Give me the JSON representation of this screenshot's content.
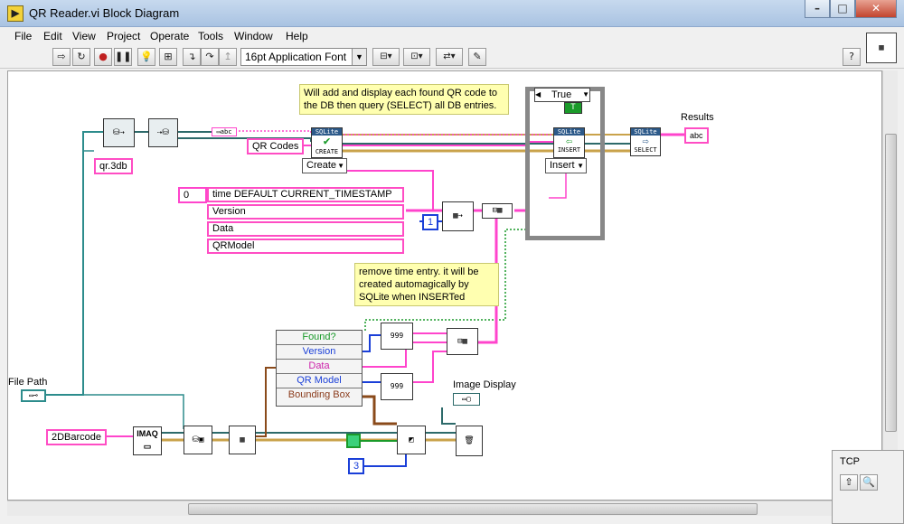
{
  "window": {
    "title": "QR Reader.vi Block Diagram",
    "controls": [
      "–",
      "□",
      "✕"
    ]
  },
  "menu": [
    "File",
    "Edit",
    "View",
    "Project",
    "Operate",
    "Tools",
    "Window",
    "Help"
  ],
  "toolbar": {
    "font_select": "16pt Application Font",
    "help_label": "?"
  },
  "diagram": {
    "comment_top": "Will add and display each found QR code to the DB then query (SELECT) all DB entries.",
    "comment_mid": "remove time entry. it will be created automagically by SQLite when INSERTed",
    "db_file": "qr.3db",
    "table_name": "QR Codes",
    "create_ring": "Create",
    "insert_ring": "Insert",
    "case_selector": "True",
    "true_const": "T",
    "index_const": "0",
    "columns": [
      "time DEFAULT CURRENT_TIMESTAMP",
      "Version",
      "Data",
      "QRModel"
    ],
    "num_const_1": "1",
    "num_const_3": "3",
    "unbundle": [
      "Found?",
      "Version",
      "Data",
      "QR Model",
      "Bounding Box"
    ],
    "results_label": "Results",
    "results_ind": "abc",
    "file_path_label": "File Path",
    "barcode_const": "2DBarcode",
    "image_display_label": "Image Display",
    "imaq_label": "IMAQ",
    "sqlite_label": "SQLite",
    "create_sub": "CREATE",
    "insert_sub": "INSERT",
    "select_sub": "SELECT",
    "num_format": "999"
  },
  "palette": {
    "title": "TCP",
    "buttons": [
      "⇧",
      "🔍"
    ]
  },
  "colors": {
    "string_wire": "#ff44cc",
    "path_wire": "#2d8c8c",
    "bool_wire": "#1a9a2a",
    "int_wire": "#1a3fd8",
    "cluster_wire": "#8a4a1a",
    "error_wire": "#c9a24a",
    "refnum_wire": "#2d6a6a"
  }
}
